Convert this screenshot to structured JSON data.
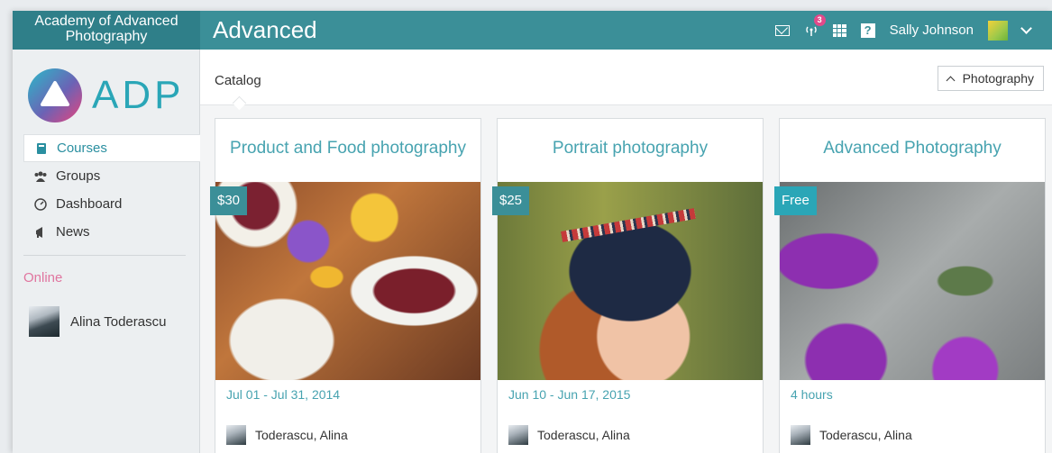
{
  "app": {
    "brand": "Academy of Advanced Photography",
    "page_title": "Advanced",
    "notification_count": "3",
    "help_label": "?",
    "user_name": "Sally Johnson"
  },
  "sidebar": {
    "logo_text": "ADP",
    "items": [
      {
        "label": "Courses",
        "icon": "book-icon"
      },
      {
        "label": "Groups",
        "icon": "users-icon"
      },
      {
        "label": "Dashboard",
        "icon": "gauge-icon"
      },
      {
        "label": "News",
        "icon": "megaphone-icon"
      }
    ],
    "online_title": "Online",
    "online_user": "Alina Toderascu"
  },
  "main": {
    "tab_label": "Catalog",
    "filter_label": "Photography",
    "cards": [
      {
        "title": "Product and Food photography",
        "price": "$30",
        "date": "Jul 01 - Jul 31, 2014",
        "author": "Toderascu, Alina"
      },
      {
        "title": "Portrait photography",
        "price": "$25",
        "date": "Jun 10 - Jun 17, 2015",
        "author": "Toderascu, Alina"
      },
      {
        "title": "Advanced Photography",
        "price": "Free",
        "date": "4 hours",
        "author": "Toderascu, Alina"
      }
    ]
  },
  "colors": {
    "topbar": "#3b8f98",
    "accent": "#47a3b0",
    "online": "#e0759f"
  }
}
